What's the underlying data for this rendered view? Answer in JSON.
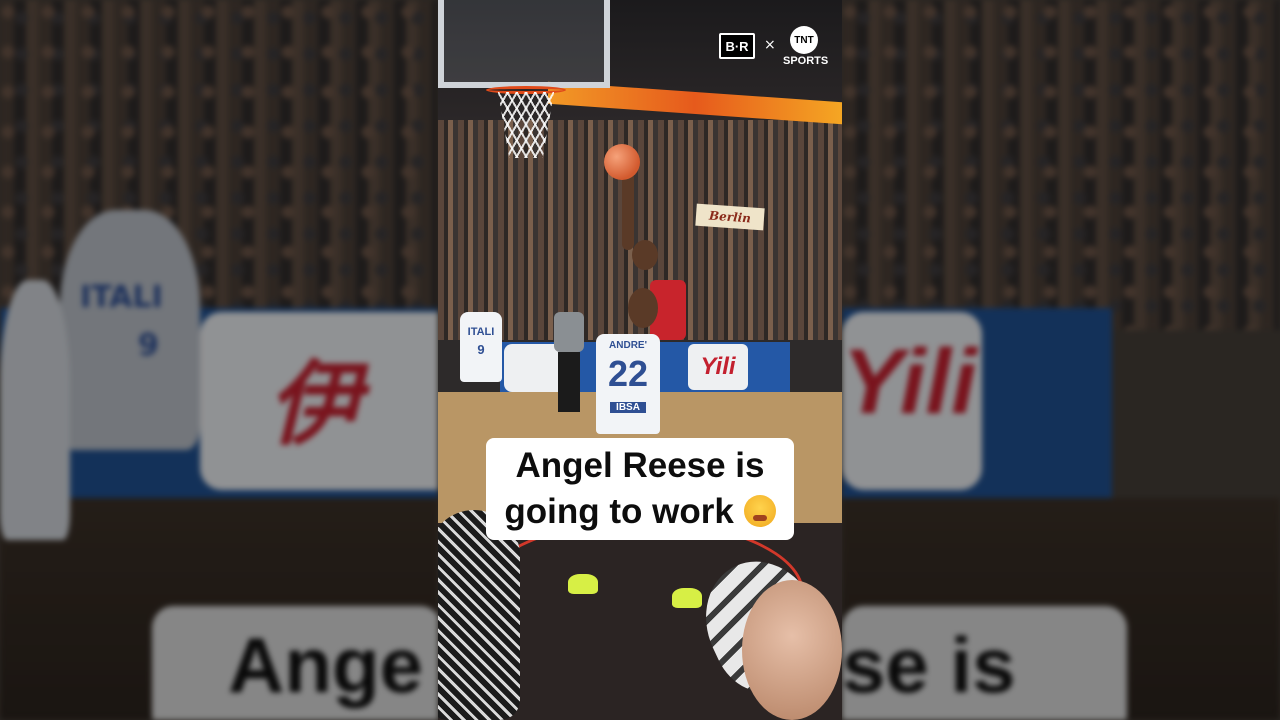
{
  "caption": {
    "line1": "Angel Reese is",
    "line2": "going to work",
    "emoji": "face-with-steam-from-nose-icon"
  },
  "logos": {
    "br": "B·R",
    "separator": "×",
    "tnt": "TNT",
    "sports": "SPORTS"
  },
  "scene": {
    "banner_berlin": "Berlin",
    "banner_yili": "Yili",
    "banner_yili_char": "伊",
    "player_front_name": "ANDRE'",
    "player_front_number": "22",
    "player_front_sponsor": "IBSA",
    "player_back_team": "ITALI",
    "player_back_number": "9",
    "side_team": "ITALI",
    "side_number": "9"
  },
  "background_text": {
    "left": "Ange",
    "right": "se is"
  },
  "colors": {
    "caption_bg": "#ffffff",
    "caption_text": "#0d0d0d",
    "yili_red": "#c3202f",
    "italy_blue": "#2f4f93",
    "usa_red": "#c8242c",
    "led_orange": "#f29a26"
  }
}
